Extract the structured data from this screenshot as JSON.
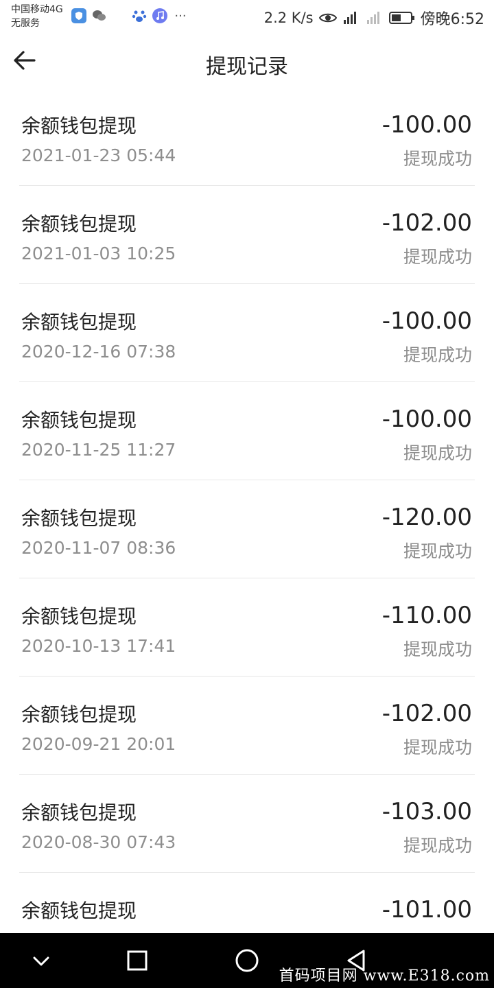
{
  "status_bar": {
    "carrier_line1": "中国移动4G",
    "carrier_line2": "无服务",
    "more": "···",
    "speed": "2.2 K/s",
    "time": "傍晚6:52",
    "icons": [
      "shield-icon",
      "wechat-icon",
      "baidu-icon",
      "music-icon",
      "eye-icon",
      "signal-icon",
      "battery-icon"
    ]
  },
  "header": {
    "title": "提现记录"
  },
  "records": [
    {
      "title": "余额钱包提现",
      "date": "2021-01-23 05:44",
      "amount": "-100.00",
      "status": "提现成功"
    },
    {
      "title": "余额钱包提现",
      "date": "2021-01-03 10:25",
      "amount": "-102.00",
      "status": "提现成功"
    },
    {
      "title": "余额钱包提现",
      "date": "2020-12-16 07:38",
      "amount": "-100.00",
      "status": "提现成功"
    },
    {
      "title": "余额钱包提现",
      "date": "2020-11-25 11:27",
      "amount": "-100.00",
      "status": "提现成功"
    },
    {
      "title": "余额钱包提现",
      "date": "2020-11-07 08:36",
      "amount": "-120.00",
      "status": "提现成功"
    },
    {
      "title": "余额钱包提现",
      "date": "2020-10-13 17:41",
      "amount": "-110.00",
      "status": "提现成功"
    },
    {
      "title": "余额钱包提现",
      "date": "2020-09-21 20:01",
      "amount": "-102.00",
      "status": "提现成功"
    },
    {
      "title": "余额钱包提现",
      "date": "2020-08-30 07:43",
      "amount": "-103.00",
      "status": "提现成功"
    },
    {
      "title": "余额钱包提现",
      "date": "",
      "amount": "-101.00",
      "status": ""
    }
  ],
  "watermark": "首码项目网 www.E318.com"
}
